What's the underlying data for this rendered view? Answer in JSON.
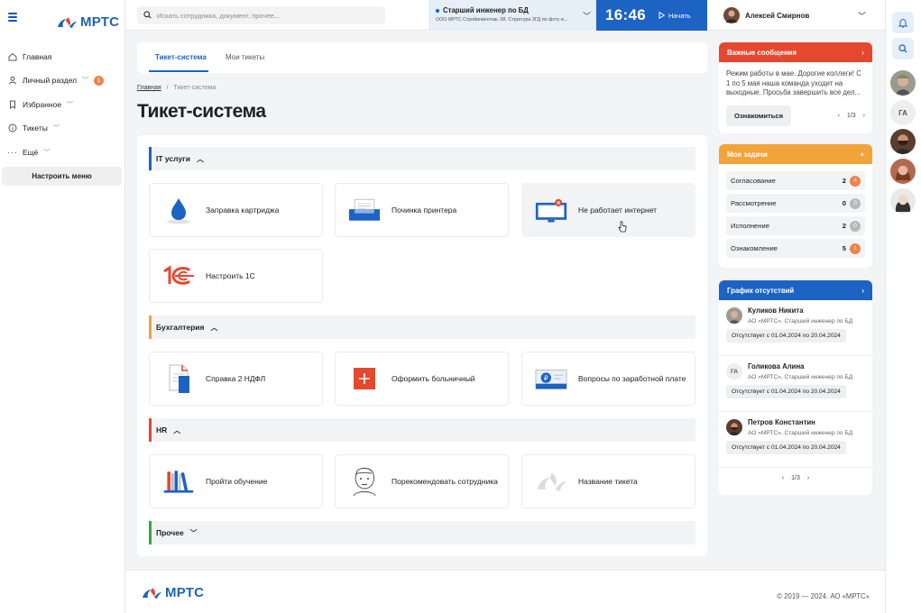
{
  "app": {
    "brand": "МРТС"
  },
  "sidebar": {
    "items": [
      {
        "label": "Главная",
        "icon": "home-icon"
      },
      {
        "label": "Личный раздел",
        "icon": "user-icon",
        "badge": "1"
      },
      {
        "label": "Избранное",
        "icon": "bookmark-icon"
      },
      {
        "label": "Тикеты",
        "icon": "info-icon"
      },
      {
        "label": "Ещё",
        "icon": "more-icon"
      }
    ],
    "configure_label": "Настроить меню"
  },
  "topbar": {
    "search_placeholder": "Искать сотрудника, документ, прочее...",
    "role_title": "Старший инженер по БД",
    "role_org": "ООО МРТС Стройинвентаж, 08. Структура ЗГД по фоту и...",
    "time": "16:46",
    "start_label": "Начать",
    "user_name": "Алексей Смирнов"
  },
  "tabs": [
    {
      "label": "Тикет-система"
    },
    {
      "label": "Мои тикеты"
    }
  ],
  "breadcrumb": {
    "home": "Главная",
    "sep": "/",
    "current": "Тикет-система"
  },
  "page_title": "Тикет-система",
  "sections": [
    {
      "title": "IT услуги",
      "color": "#1d63c4",
      "expanded": true,
      "cards": [
        {
          "label": "Заправка картриджа",
          "icon": "water-drop-icon"
        },
        {
          "label": "Починка принтера",
          "icon": "printer-icon"
        },
        {
          "label": "Не работает интернет",
          "icon": "monitor-error-icon"
        },
        {
          "label": "Настроить 1С",
          "icon": "1c-logo-icon"
        }
      ]
    },
    {
      "title": "Бухгалтерия",
      "color": "#f2a33a",
      "expanded": true,
      "cards": [
        {
          "label": "Справка 2 НДФЛ",
          "icon": "document-icon"
        },
        {
          "label": "Оформить больничный",
          "icon": "medical-cross-icon"
        },
        {
          "label": "Вопросы по заработной плате",
          "icon": "salary-icon"
        }
      ]
    },
    {
      "title": "HR",
      "color": "#e5482f",
      "expanded": true,
      "cards": [
        {
          "label": "Пройти обучение",
          "icon": "books-icon"
        },
        {
          "label": "Порекомендовать сотрудника",
          "icon": "employee-sketch-icon"
        },
        {
          "label": "Название тикета",
          "icon": "brand-watermark-icon"
        }
      ]
    },
    {
      "title": "Прочее",
      "color": "#2fa845",
      "expanded": false,
      "cards": []
    }
  ],
  "important": {
    "title": "Важные сообщения",
    "text": "Режим работы в мае. Дорогие коллеги! С 1 по 5 мая наша команда уходит на выходные. Просьба завершить все дел...",
    "button": "Ознакомиться",
    "pager": "1/3",
    "color": "#e5482f"
  },
  "tasks": {
    "title": "Мои задачи",
    "plus": "+",
    "color": "#f2a33a",
    "items": [
      {
        "label": "Согласование",
        "count": "2",
        "badge": "4",
        "badge_color": "#f0824a"
      },
      {
        "label": "Рассмотрение",
        "count": "0",
        "badge": "0",
        "badge_color": "#b8b8b8"
      },
      {
        "label": "Исполнение",
        "count": "2",
        "badge": "0",
        "badge_color": "#b8b8b8"
      },
      {
        "label": "Ознакомление",
        "count": "5",
        "badge": "1",
        "badge_color": "#f0824a"
      }
    ]
  },
  "absence": {
    "title": "График отсутствий",
    "color": "#1d63c4",
    "pager": "1/3",
    "people": [
      {
        "name": "Куликов Никита",
        "role": "АО «МРТС», Старший инженер по БД",
        "dates": "Отсутствует с 01.04.2024 по 20.04.2024",
        "initials": ""
      },
      {
        "name": "Голикова Алина",
        "role": "АО «МРТС», Старший инженер по БД",
        "dates": "Отсутствует с 01.04.2024 по 20.04.2024",
        "initials": "ГА"
      },
      {
        "name": "Петров Константин",
        "role": "АО «МРТС», Старший инженер по БД",
        "dates": "Отсутствует с 01.04.2024 по 20.04.2024",
        "initials": ""
      }
    ]
  },
  "rail": {
    "initials": "ГА"
  },
  "footer": {
    "copyright": "© 2019 — 2024. АО «МРТС»"
  }
}
